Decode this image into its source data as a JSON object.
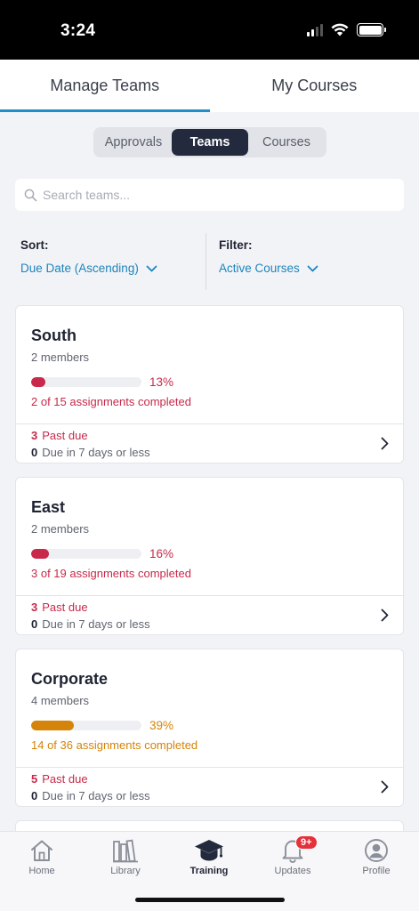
{
  "status_bar": {
    "time": "3:24"
  },
  "top_tabs": [
    {
      "label": "Manage Teams",
      "active": true
    },
    {
      "label": "My Courses",
      "active": false
    }
  ],
  "segments": [
    {
      "label": "Approvals",
      "active": false
    },
    {
      "label": "Teams",
      "active": true
    },
    {
      "label": "Courses",
      "active": false
    }
  ],
  "search": {
    "placeholder": "Search teams..."
  },
  "sort": {
    "label": "Sort:",
    "value": "Due Date (Ascending)"
  },
  "filter": {
    "label": "Filter:",
    "value": "Active Courses"
  },
  "teams": [
    {
      "name": "South",
      "members": "2 members",
      "percent_label": "13%",
      "progress": 0.13,
      "completed": "2 of 15 assignments completed",
      "past_due_count": "3",
      "past_due_label": "Past due",
      "due_soon_count": "0",
      "due_soon_label": "Due in 7 days or less",
      "color": "#c8294a"
    },
    {
      "name": "East",
      "members": "2 members",
      "percent_label": "16%",
      "progress": 0.16,
      "completed": "3 of 19 assignments completed",
      "past_due_count": "3",
      "past_due_label": "Past due",
      "due_soon_count": "0",
      "due_soon_label": "Due in 7 days or less",
      "color": "#c8294a"
    },
    {
      "name": "Corporate",
      "members": "4 members",
      "percent_label": "39%",
      "progress": 0.39,
      "completed": "14 of 36 assignments completed",
      "past_due_count": "5",
      "past_due_label": "Past due",
      "due_soon_count": "0",
      "due_soon_label": "Due in 7 days or less",
      "color": "#d48408"
    }
  ],
  "bottom_nav": [
    {
      "label": "Home",
      "icon": "home-icon"
    },
    {
      "label": "Library",
      "icon": "library-icon"
    },
    {
      "label": "Training",
      "icon": "graduation-cap-icon",
      "active": true
    },
    {
      "label": "Updates",
      "icon": "bell-icon",
      "badge": "9+"
    },
    {
      "label": "Profile",
      "icon": "profile-icon"
    }
  ],
  "colors": {
    "accent": "#1f8fc8",
    "link": "#1d85bb",
    "danger": "#c8294a",
    "warning": "#d48408",
    "dark": "#232a3d"
  }
}
